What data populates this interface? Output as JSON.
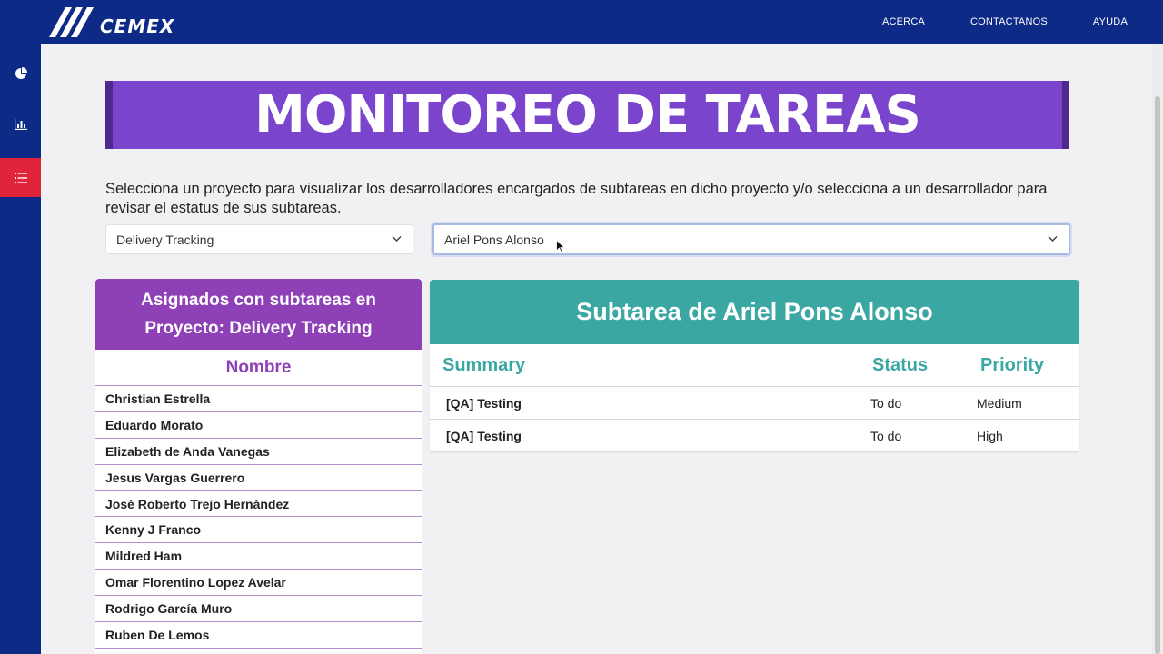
{
  "header": {
    "logo_text": "CEMEX",
    "nav": [
      "ACERCA",
      "CONTACTANOS",
      "AYUDA"
    ]
  },
  "sidebar": {
    "items": [
      {
        "icon": "pie-chart-icon",
        "active": false
      },
      {
        "icon": "bar-chart-icon",
        "active": false
      },
      {
        "icon": "task-list-icon",
        "active": true
      }
    ]
  },
  "page": {
    "title": "MONITOREO DE TAREAS",
    "instructions": "Selecciona un proyecto para visualizar los desarrolladores encargados de subtareas en dicho proyecto y/o selecciona a un desarrollador para revisar el estatus de sus subtareas."
  },
  "filters": {
    "project_value": "Delivery Tracking",
    "developer_value": "Ariel Pons Alonso"
  },
  "assigned": {
    "title_line1": "Asignados con subtareas en",
    "title_line2": "Proyecto: Delivery Tracking",
    "column": "Nombre",
    "names": [
      "Christian Estrella",
      "Eduardo Morato",
      "Elizabeth de Anda Vanegas",
      "Jesus Vargas Guerrero",
      "José Roberto Trejo Hernández",
      "Kenny J Franco",
      "Mildred Ham",
      "Omar Florentino Lopez Avelar",
      "Rodrigo García Muro",
      "Ruben De Lemos"
    ]
  },
  "subtasks": {
    "title": "Subtarea de Ariel Pons Alonso",
    "columns": {
      "summary": "Summary",
      "status": "Status",
      "priority": "Priority"
    },
    "rows": [
      {
        "summary": "[QA] Testing",
        "status": "To do",
        "priority": "Medium"
      },
      {
        "summary": "[QA] Testing",
        "status": "To do",
        "priority": "High"
      }
    ]
  },
  "colors": {
    "navy": "#0c2a86",
    "banner_purple": "#7a45cc",
    "card_purple": "#8e40b6",
    "teal": "#3ba7a3",
    "active_red": "#e0243a"
  }
}
